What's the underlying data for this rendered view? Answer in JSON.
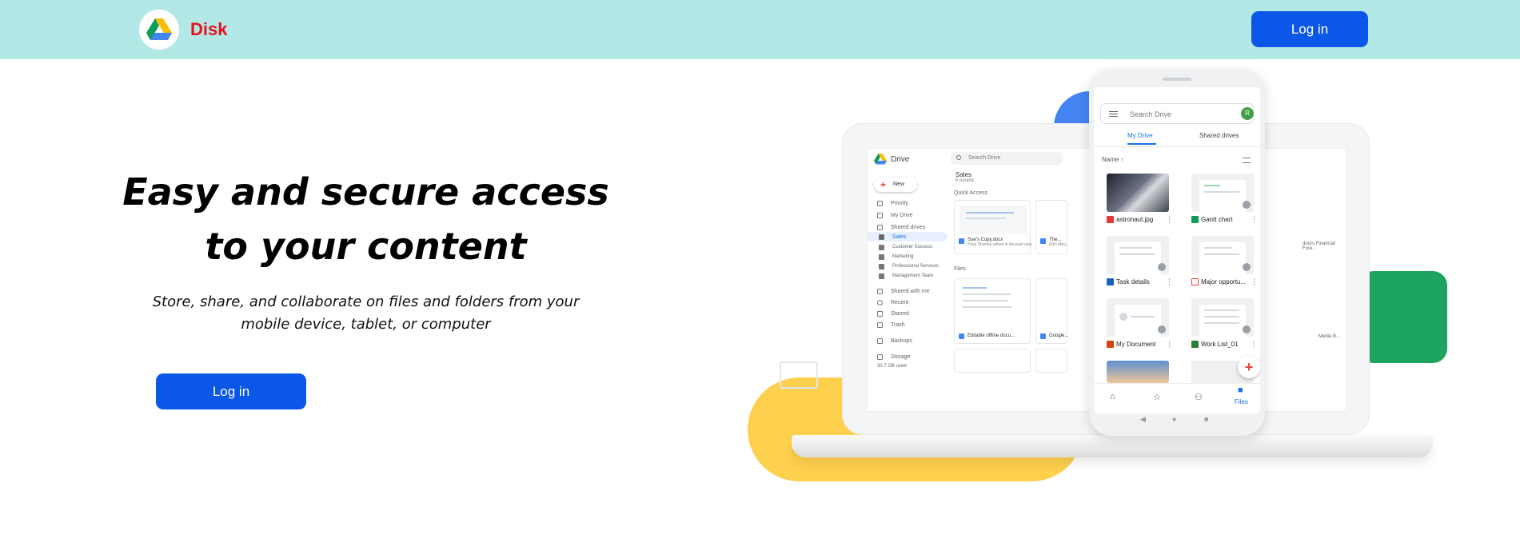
{
  "header": {
    "brand_name": "Disk",
    "login_label": "Log in"
  },
  "hero": {
    "title_line1": "Easy and secure access",
    "title_line2": "to your content",
    "subtitle": "Store, share, and collaborate on files and folders from your mobile device, tablet, or computer",
    "login_label": "Log in"
  },
  "colors": {
    "header_bg": "#b2e8e6",
    "brand_red": "#e8111c",
    "button_blue": "#0b57e8",
    "accent_yellow": "#fdd04d",
    "accent_blue": "#4284f3",
    "accent_green": "#1da460"
  },
  "icons": {
    "logo": "google-drive-logo",
    "illustration": "drive-devices-illustration"
  },
  "laptop": {
    "app_name": "Drive",
    "new_label": "New",
    "search_placeholder": "Search Drive",
    "sidebar": [
      "Priority",
      "My Drive",
      "Shared drives",
      "Sales",
      "Customer Success",
      "Marketing",
      "Professional Services",
      "Management Team",
      "Shared with me",
      "Recent",
      "Starred",
      "Trash",
      "Backups",
      "Storage"
    ],
    "storage_used": "30.7 GB used",
    "folder_name": "Sales",
    "folder_members": "5 people",
    "quick_access_label": "Quick Access",
    "files_label": "Files",
    "quick_cards": [
      {
        "name": "Sue's Copy.docx",
        "meta": "Priya Sharma edited in the past year"
      },
      {
        "name": "The...",
        "meta": "Rich Mey..."
      }
    ],
    "file_cards": [
      {
        "name": "Editable offline docu..."
      },
      {
        "name": "Google..."
      }
    ],
    "right_edge_text": "doors Financial Fore...",
    "right_edge_text2": "Media B..."
  },
  "phone": {
    "search_placeholder": "Search Drive",
    "avatar_initial": "R",
    "tabs": [
      "My Drive",
      "Shared drives"
    ],
    "sort_label": "Name ↑",
    "files": [
      "astronaut.jpg",
      "Gantt chart",
      "Task details",
      "Major opportu...",
      "My Document",
      "Work List_01"
    ],
    "nav_files_label": "Files"
  }
}
